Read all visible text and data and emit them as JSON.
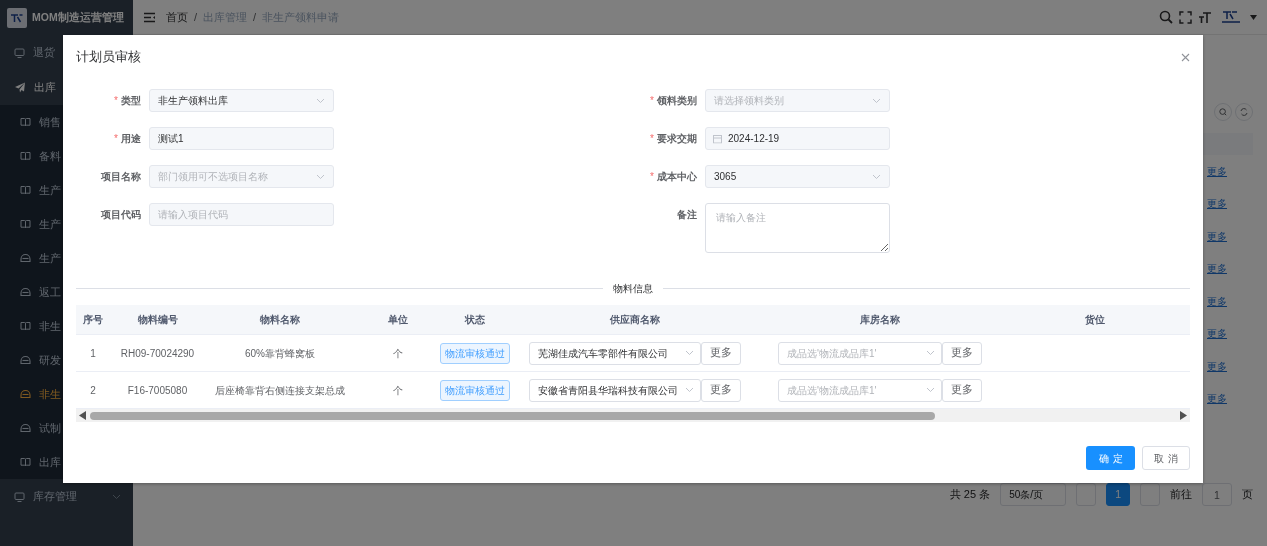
{
  "app": {
    "title": "MOM制造运营管理"
  },
  "sidebar": {
    "items": [
      {
        "label": "退货"
      },
      {
        "label": "出库",
        "children": [
          {
            "label": "销售",
            "kind": "book",
            "selected": false
          },
          {
            "label": "备料",
            "kind": "book",
            "selected": false
          },
          {
            "label": "生产",
            "kind": "book",
            "selected": false
          },
          {
            "label": "生产",
            "kind": "book",
            "selected": false
          },
          {
            "label": "生产",
            "kind": "helmet",
            "selected": false
          },
          {
            "label": "返工",
            "kind": "helmet",
            "selected": false
          },
          {
            "label": "非生",
            "kind": "book",
            "selected": false
          },
          {
            "label": "研发",
            "kind": "helmet",
            "selected": false
          },
          {
            "label": "非生",
            "kind": "helmet",
            "selected": true
          },
          {
            "label": "试制",
            "kind": "helmet",
            "selected": false
          },
          {
            "label": "出库",
            "kind": "book",
            "selected": false
          }
        ]
      },
      {
        "label": "库存管理"
      }
    ]
  },
  "breadcrumb": {
    "items": [
      "首页",
      "出库管理",
      "非生产领料申请"
    ],
    "separators": [
      "/",
      "/"
    ]
  },
  "background": {
    "more_links": [
      "更多",
      "更多",
      "更多",
      "更多",
      "更多",
      "更多",
      "更多",
      "更多"
    ],
    "pagination": {
      "total": "共 25 条",
      "page_size": "50条/页",
      "current": "1",
      "goto_label": "前往",
      "goto_value": "1",
      "page_unit": "页"
    }
  },
  "dialog": {
    "title": "计划员审核",
    "form": {
      "left": [
        {
          "label": "类型",
          "required_mark": "*",
          "kind": "select",
          "value": "非生产领料出库"
        },
        {
          "label": "用途",
          "required_mark": "*",
          "kind": "input",
          "value": "测试1"
        },
        {
          "label": "项目名称",
          "kind": "select",
          "placeholder": "部门领用可不选项目名称"
        },
        {
          "label": "项目代码",
          "kind": "input",
          "placeholder": "请输入项目代码"
        }
      ],
      "right": [
        {
          "label": "领料类别",
          "required_mark": "*",
          "kind": "select",
          "placeholder": "请选择领料类别"
        },
        {
          "label": "要求交期",
          "required_mark": "*",
          "kind": "date",
          "value": "2024-12-19"
        },
        {
          "label": "成本中心",
          "required_mark": "*",
          "kind": "select",
          "value": "3065"
        },
        {
          "label": "备注",
          "kind": "textarea",
          "placeholder": "请输入备注"
        }
      ]
    },
    "section_title": "物料信息",
    "table": {
      "columns": [
        "序号",
        "物料编号",
        "物料名称",
        "单位",
        "状态",
        "供应商名称",
        "库房名称",
        "货位"
      ],
      "rows": [
        {
          "index": "1",
          "code": "RH09-70024290",
          "name": "60%靠背蜂窝板",
          "unit": "个",
          "status": "物流审核通过",
          "supplier": "芜湖佳成汽车零部件有限公司",
          "supplier_button": "更多",
          "warehouse_placeholder": "成品选'物流成品库1'",
          "warehouse_button": "更多"
        },
        {
          "index": "2",
          "code": "F16-7005080",
          "name": "后座椅靠背右侧连接支架总成",
          "unit": "个",
          "status": "物流审核通过",
          "supplier": "安徽省青阳县华瑞科技有限公司",
          "supplier_button": "更多",
          "warehouse_placeholder": "成品选'物流成品库1'",
          "warehouse_button": "更多"
        }
      ]
    },
    "buttons": [
      {
        "label": "确定",
        "kind": "primary"
      },
      {
        "label": "取消",
        "kind": "default"
      }
    ]
  }
}
